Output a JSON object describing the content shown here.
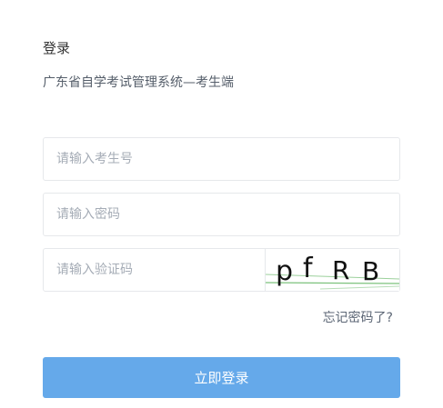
{
  "login": {
    "title": "登录",
    "subtitle": "广东省自学考试管理系统—考生端",
    "username_placeholder": "请输入考生号",
    "password_placeholder": "请输入密码",
    "captcha_placeholder": "请输入验证码",
    "captcha_text": [
      "p",
      "f",
      "R",
      "B"
    ],
    "forgot_label": "忘记密码了?",
    "submit_label": "立即登录"
  },
  "colors": {
    "primary_button": "#65a9ea",
    "input_border": "#e6e8eb",
    "placeholder": "#a5acb6",
    "captcha_line": "#7cc27c"
  }
}
